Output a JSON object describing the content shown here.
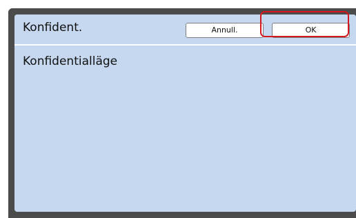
{
  "header": {
    "title": "Konfident.",
    "cancel_label": "Annull.",
    "ok_label": "OK"
  },
  "content": {
    "mode_label": "Konfidentialläge"
  },
  "colors": {
    "panel_background": "#c6d8ef",
    "frame": "#4b4b4b",
    "highlight": "#d7151f"
  }
}
